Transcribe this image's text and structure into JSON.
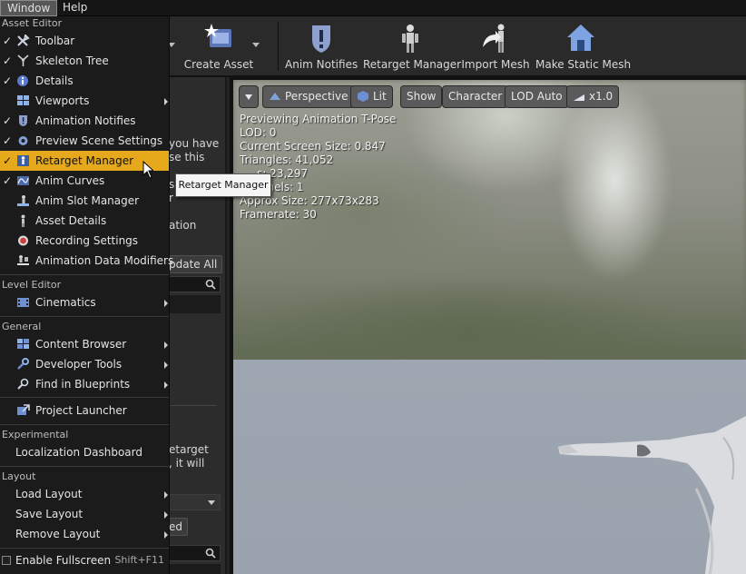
{
  "menubar": {
    "window": "Window",
    "help": "Help"
  },
  "toolbar": {
    "create_asset": "Create Asset",
    "anim_notifies": "Anim Notifies",
    "retarget_manager": "Retarget Manager",
    "import_mesh": "Import Mesh",
    "make_static_mesh": "Make Static Mesh"
  },
  "left_panel": {
    "frag_you_have": "you have",
    "frag_se_this": "se this",
    "frag_s": "s",
    "frag_r": "r",
    "frag_ation": "ation",
    "update_all": "pdate All",
    "frag_etarget": "etarget",
    "frag_it_will": ", it will",
    "frag_ed": "ed"
  },
  "viewport": {
    "perspective": "Perspective",
    "lit": "Lit",
    "show": "Show",
    "character": "Character",
    "lod_auto": "LOD Auto",
    "speed": "x1.0",
    "stats": [
      "Previewing Animation T-Pose",
      "LOD: 0",
      "Current Screen Size: 0.847",
      "Triangles: 41,052",
      "     s: 23,297",
      "      nnels: 1",
      "Approx Size: 277x73x283",
      "Framerate: 30"
    ]
  },
  "menu": {
    "sections": {
      "asset_editor": "Asset Editor",
      "level_editor": "Level Editor",
      "general": "General",
      "experimental": "Experimental",
      "layout": "Layout"
    },
    "items": {
      "toolbar": "Toolbar",
      "skeleton_tree": "Skeleton Tree",
      "details": "Details",
      "viewports": "Viewports",
      "animation_notifies": "Animation Notifies",
      "preview_scene_settings": "Preview Scene Settings",
      "retarget_manager": "Retarget Manager",
      "anim_curves": "Anim Curves",
      "anim_slot_manager": "Anim Slot Manager",
      "asset_details": "Asset Details",
      "recording_settings": "Recording Settings",
      "animation_data_modifiers": "Animation Data Modifiers",
      "cinematics": "Cinematics",
      "content_browser": "Content Browser",
      "developer_tools": "Developer Tools",
      "find_in_blueprints": "Find in Blueprints",
      "project_launcher": "Project Launcher",
      "localization_dashboard": "Localization Dashboard",
      "load_layout": "Load Layout",
      "save_layout": "Save Layout",
      "remove_layout": "Remove Layout",
      "enable_fullscreen": "Enable Fullscreen",
      "enable_fullscreen_shortcut": "Shift+F11"
    },
    "check_glyph": "✓"
  },
  "tooltip": "Retarget Manager",
  "colors": {
    "highlight": "#e7a91c",
    "menu_bg": "#1b1b1b"
  },
  "icons": [
    "toolbar-icon",
    "skeleton-tree-icon",
    "details-icon",
    "viewports-icon",
    "notify-icon",
    "scene-settings-icon",
    "retarget-icon",
    "curves-icon",
    "slot-icon",
    "asset-details-icon",
    "record-icon",
    "modifiers-icon",
    "cinematics-icon",
    "content-browser-icon",
    "developer-tools-icon",
    "find-icon",
    "launcher-icon"
  ]
}
